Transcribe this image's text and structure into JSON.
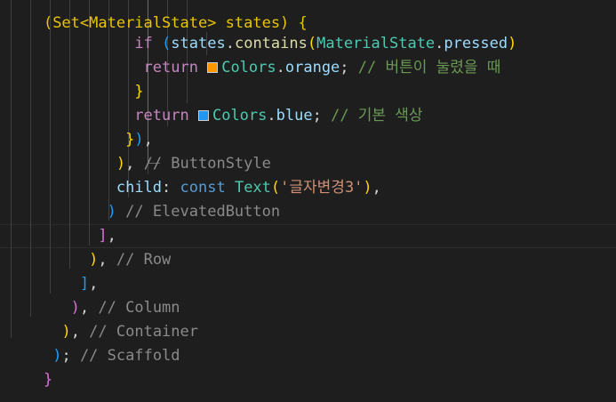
{
  "editor": {
    "lines": [
      "(Set<MaterialState> states) {",
      "if (states.contains(MaterialState.pressed)",
      "return ",
      "Colors.orange; // 버튼이 눌렸을 때",
      "}",
      "return ",
      "Colors.blue; // 기본 색상",
      "}),",
      "), // ButtonStyle",
      "child: const Text('글자변경3'),",
      ") // ElevatedButton",
      "],",
      "), // Row",
      "],",
      "), // Column",
      "), // Container",
      "); // Scaffold",
      "}"
    ],
    "colors": {
      "orange_swatch": "#ff9800",
      "blue_swatch": "#2196f3",
      "background": "#1e1e1e"
    }
  }
}
